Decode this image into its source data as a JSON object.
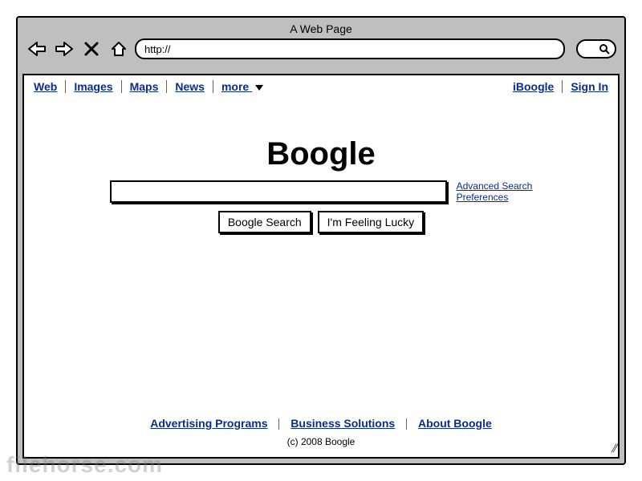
{
  "window": {
    "title": "A Web Page",
    "url": "http://"
  },
  "nav": {
    "left": [
      "Web",
      "Images",
      "Maps",
      "News",
      "more"
    ],
    "active_index": 0,
    "right": [
      "iBoogle",
      "Sign In"
    ]
  },
  "brand": "Boogle",
  "side_links": [
    "Advanced Search",
    "Preferences"
  ],
  "buttons": {
    "search": "Boogle Search",
    "lucky": "I'm Feeling Lucky"
  },
  "footer": {
    "links": [
      "Advertising Programs",
      "Business Solutions",
      "About Boogle"
    ],
    "copyright": "(c) 2008 Boogle"
  },
  "watermark": "filehorse.com"
}
